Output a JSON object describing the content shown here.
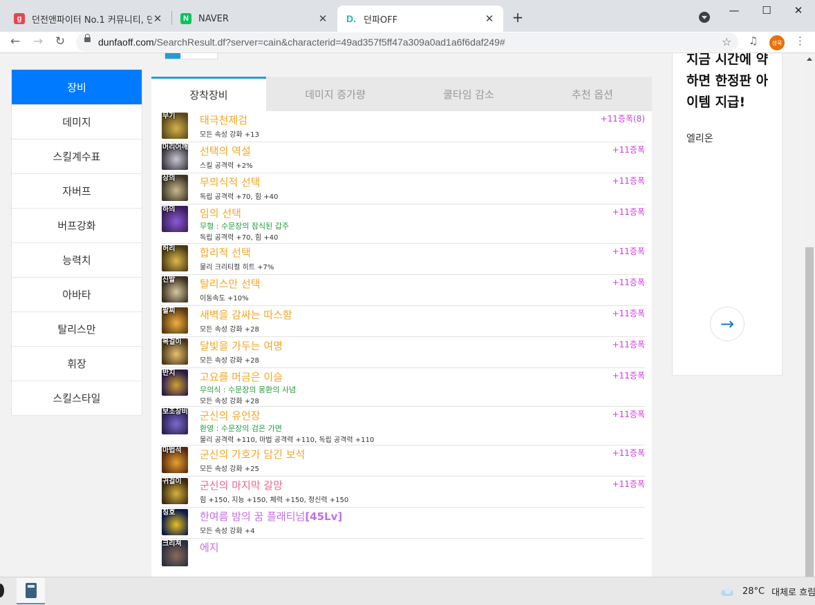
{
  "browser": {
    "tabs": [
      {
        "fav_text": "g",
        "fav_color": "#e5474f",
        "title": "던전앤파이터 No.1 커뮤니티, 던"
      },
      {
        "fav_text": "N",
        "fav_color": "#03c75a",
        "title": "NAVER"
      },
      {
        "fav_text": "D.",
        "fav_color": "#ffffff",
        "fav_fg": "#1fb5a8",
        "title": "던파OFF"
      }
    ],
    "close_glyph": "✕",
    "new_tab_glyph": "+",
    "url_host": "dunfaoff.com",
    "url_path": "/SearchResult.df?server=cain&characterid=49ad357f5ff47a309a0ad1a6f6daf249#",
    "profile_text": "성욱"
  },
  "sidebar": {
    "items": [
      {
        "label": "장비",
        "active": true
      },
      {
        "label": "데미지"
      },
      {
        "label": "스킬계수표"
      },
      {
        "label": "자버프"
      },
      {
        "label": "버프강화"
      },
      {
        "label": "능력치"
      },
      {
        "label": "아바타"
      },
      {
        "label": "탈리스만"
      },
      {
        "label": "휘장"
      },
      {
        "label": "스킬스타일"
      }
    ]
  },
  "equip_tabs": [
    "장착장비",
    "데미지 증가량",
    "쿨타임 감소",
    "추천 옵션"
  ],
  "equipment": [
    {
      "slot": "무기",
      "name": "태극천제검",
      "name_color": "#f5a623",
      "sub": "",
      "opts": [
        "모든 속성 강화 +13"
      ],
      "enh": "+11증폭",
      "enh_count": "(8)",
      "icon_bg": "#5b4a1c",
      "icon_fg": "#d7b24a"
    },
    {
      "slot": "머리어깨",
      "name": "선택의 역설",
      "name_color": "#f5a623",
      "sub": "",
      "opts": [
        "스킬 공격력 +2%"
      ],
      "enh": "+11증폭",
      "icon_bg": "#3a3540",
      "icon_fg": "#c8c8d2"
    },
    {
      "slot": "상의",
      "name": "무의식적 선택",
      "name_color": "#f5a623",
      "sub": "",
      "opts": [
        "독립 공격력 +70, 힘 +40"
      ],
      "enh": "+11증폭",
      "icon_bg": "#3d3628",
      "icon_fg": "#c9b98a"
    },
    {
      "slot": "하의",
      "name": "임의 선택",
      "name_color": "#f5a623",
      "sub": "무형 : 수문장의 잠식된 갑주",
      "opts": [
        "독립 공격력 +70, 힘 +40"
      ],
      "enh": "+11증폭",
      "icon_bg": "#3a1f5c",
      "icon_fg": "#8a5bd6"
    },
    {
      "slot": "허리",
      "name": "합리적 선택",
      "name_color": "#f5a623",
      "sub": "",
      "opts": [
        "물리 크리티컬 히트 +7%"
      ],
      "enh": "+11증폭",
      "icon_bg": "#4a3a14",
      "icon_fg": "#e0b94a"
    },
    {
      "slot": "신발",
      "name": "탈리스만 선택",
      "name_color": "#f5a623",
      "sub": "",
      "opts": [
        "이동속도 +10%"
      ],
      "enh": "+11증폭",
      "icon_bg": "#3c3020",
      "icon_fg": "#d8c8a0"
    },
    {
      "slot": "팔찌",
      "name": "새벽을 감싸는 따스함",
      "name_color": "#f5a623",
      "sub": "",
      "opts": [
        "모든 속성 강화 +28"
      ],
      "enh": "+11증폭",
      "icon_bg": "#5a3a10",
      "icon_fg": "#f0b040"
    },
    {
      "slot": "목걸이",
      "name": "달빛을 가두는 여명",
      "name_color": "#f5a623",
      "sub": "",
      "opts": [
        "모든 속성 강화 +28"
      ],
      "enh": "+11증폭",
      "icon_bg": "#4a3818",
      "icon_fg": "#e8c070"
    },
    {
      "slot": "반지",
      "name": "고요를 머금은 이슬",
      "name_color": "#f5a623",
      "sub": "무의식 : 수문장의 몽환의 사념",
      "opts": [
        "모든 속성 강화 +28"
      ],
      "enh": "+11증폭",
      "icon_bg": "#2a1a4a",
      "icon_fg": "#d0a030"
    },
    {
      "slot": "보조장비",
      "name": "군신의 유언장",
      "name_color": "#f5a623",
      "sub": "환영 : 수문장의 검은 가면",
      "opts": [
        "물리 공격력 +110, 마법 공격력 +110, 독립 공격력 +110"
      ],
      "enh": "+11증폭",
      "icon_bg": "#2c2050",
      "icon_fg": "#7a6ad0"
    },
    {
      "slot": "마법석",
      "name": "군신의 가호가 담긴 보석",
      "name_color": "#f5a623",
      "sub": "",
      "opts": [
        "모든 속성 강화 +25"
      ],
      "enh": "+11증폭",
      "icon_bg": "#5a2a10",
      "icon_fg": "#e8a030"
    },
    {
      "slot": "귀걸이",
      "name": "군신의 마지막 갈망",
      "name_color": "#f0648c",
      "sub": "",
      "opts": [
        "힘 +150, 지능 +150, 체력 +150, 정신력 +150"
      ],
      "enh": "+11증폭",
      "icon_bg": "#3a2c10",
      "icon_fg": "#d8b040"
    },
    {
      "slot": "칭호",
      "name": "한여름 밤의 꿈 플래티넘",
      "name_color": "#c46fe4",
      "lv": "[45Lv]",
      "sub": "",
      "opts": [
        "모든 속성 강화 +4"
      ],
      "enh": "",
      "icon_bg": "#0a1a4a",
      "icon_fg": "#e8c020"
    },
    {
      "slot": "크리쳐",
      "name": "에지",
      "name_color": "#c46fe4",
      "sub": "",
      "opts": [],
      "enh": "",
      "icon_bg": "#2a3040",
      "icon_fg": "#8a6a5a"
    }
  ],
  "ad": {
    "headline": "지금 시간에 약하면 한정판 아이템 지급!",
    "sub": "엘리온",
    "arrow": "→"
  },
  "taskbar": {
    "weather_temp": "28°C",
    "weather_text": "대체로 흐림"
  }
}
